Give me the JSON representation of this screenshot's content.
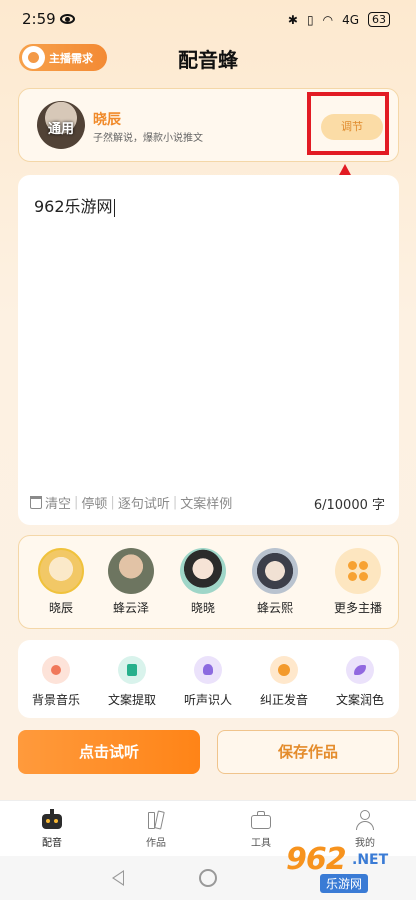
{
  "status_bar": {
    "time": "2:59",
    "signal_text": "4G",
    "battery": "63"
  },
  "header": {
    "title": "配音蜂",
    "anchor_request_label": "主播需求"
  },
  "voice_card": {
    "avatar_tag": "通用",
    "name": "晓辰",
    "description": "子然解说，爆款小说推文",
    "adjust_label": "调节"
  },
  "editor": {
    "content": "962乐游网",
    "tools": [
      "清空",
      "停顿",
      "逐句试听",
      "文案样例"
    ],
    "char_count": "6/10000 字"
  },
  "anchors": [
    {
      "name": "晓辰",
      "color": "#f2c866"
    },
    {
      "name": "蜂云泽",
      "color": "#6d7560"
    },
    {
      "name": "晓晓",
      "color": "#9fd6c8"
    },
    {
      "name": "蜂云熙",
      "color": "#b9c3cf"
    },
    {
      "name": "更多主播",
      "color": "#fde6c0"
    }
  ],
  "functions": [
    {
      "label": "背景音乐",
      "bg": "#fde3d9",
      "fg": "#f0785a"
    },
    {
      "label": "文案提取",
      "bg": "#d9f3ec",
      "fg": "#27b08c"
    },
    {
      "label": "听声识人",
      "bg": "#ebe2fb",
      "fg": "#8c6be0"
    },
    {
      "label": "纠正发音",
      "bg": "#ffe8cc",
      "fg": "#f39a2c"
    },
    {
      "label": "文案润色",
      "bg": "#ebe2fb",
      "fg": "#9168e0"
    }
  ],
  "actions": {
    "listen_label": "点击试听",
    "save_label": "保存作品"
  },
  "nav": [
    {
      "label": "配音",
      "icon": "robot-icon"
    },
    {
      "label": "作品",
      "icon": "books-icon"
    },
    {
      "label": "工具",
      "icon": "toolbox-icon"
    },
    {
      "label": "我的",
      "icon": "user-icon"
    }
  ],
  "watermark": {
    "big": "962",
    "dot": ".NET",
    "small": "乐游网"
  },
  "colors": {
    "accent": "#ff8a1f",
    "highlight": "#e21b23"
  }
}
